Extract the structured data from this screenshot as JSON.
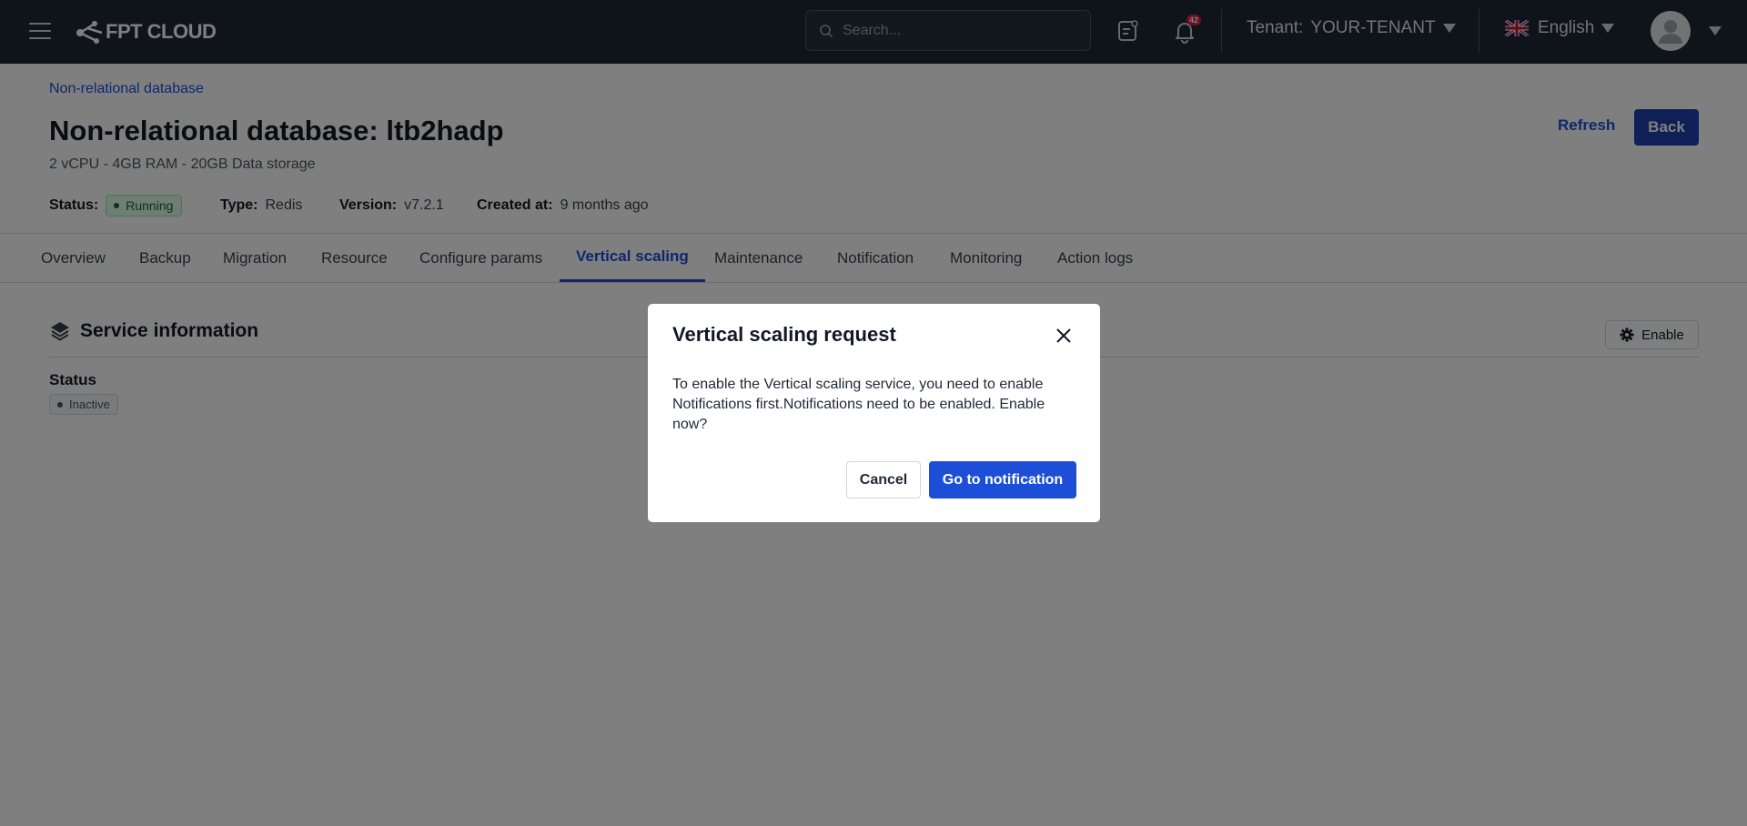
{
  "topbar": {
    "logo_text": "FPT CLOUD",
    "search_placeholder": "Search...",
    "notification_count": "42",
    "tenant_label": "Tenant:",
    "tenant_value": "YOUR-TENANT",
    "language": "English"
  },
  "page": {
    "breadcrumb": "Non-relational database",
    "title": "Non-relational database: ltb2hadp",
    "subtitle": "2 vCPU - 4GB RAM - 20GB Data storage",
    "refresh_label": "Refresh",
    "back_label": "Back",
    "meta": {
      "status_key": "Status:",
      "status_value": "Running",
      "type_key": "Type:",
      "type_value": "Redis",
      "version_key": "Version:",
      "version_value": "v7.2.1",
      "created_key": "Created at:",
      "created_value": "9 months ago"
    }
  },
  "tabs": [
    {
      "label": "Overview"
    },
    {
      "label": "Backup"
    },
    {
      "label": "Migration"
    },
    {
      "label": "Resource"
    },
    {
      "label": "Configure params"
    },
    {
      "label": "Vertical scaling"
    },
    {
      "label": "Maintenance"
    },
    {
      "label": "Notification"
    },
    {
      "label": "Monitoring"
    },
    {
      "label": "Action logs"
    }
  ],
  "active_tab": "Vertical scaling",
  "service": {
    "title": "Service information",
    "enable_label": "Enable",
    "status_label": "Status",
    "status_value": "Inactive"
  },
  "modal": {
    "title": "Vertical scaling request",
    "body": "To enable the Vertical scaling service, you need to enable Notifications first.Notifications need to be enabled. Enable now?",
    "cancel_label": "Cancel",
    "confirm_label": "Go to notification"
  },
  "colors": {
    "navbar": "#1f2937",
    "primary": "#1d4ed8",
    "running_bg": "#dcfce7",
    "running_text": "#166534"
  }
}
